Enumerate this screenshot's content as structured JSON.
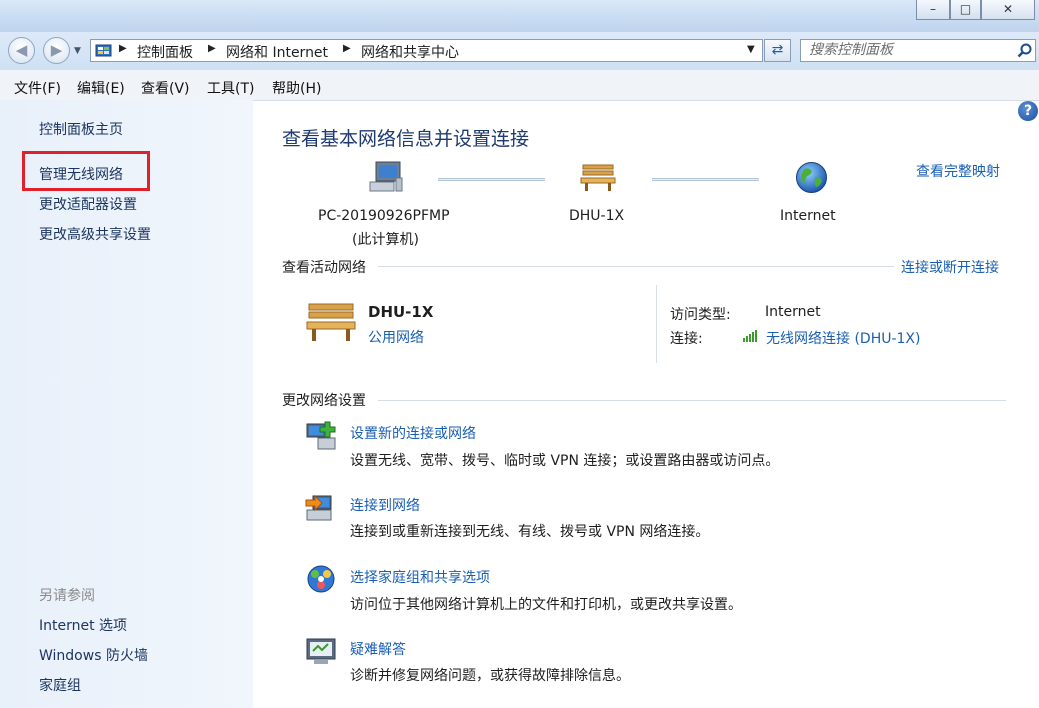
{
  "window": {
    "minimize": "–",
    "maximize": "□",
    "close": "✕"
  },
  "address": {
    "breadcrumb": [
      "控制面板",
      "网络和 Internet",
      "网络和共享中心"
    ],
    "search_placeholder": "搜索控制面板"
  },
  "menu": [
    "文件(F)",
    "编辑(E)",
    "查看(V)",
    "工具(T)",
    "帮助(H)"
  ],
  "sidebar": {
    "home": "控制面板主页",
    "links": [
      "管理无线网络",
      "更改适配器设置",
      "更改高级共享设置"
    ],
    "see_also_title": "另请参阅",
    "see_also": [
      "Internet 选项",
      "Windows 防火墙",
      "家庭组"
    ]
  },
  "main": {
    "title": "查看基本网络信息并设置连接",
    "view_full_map": "查看完整映射",
    "map": {
      "computer_name": "PC-20190926PFMP",
      "computer_sub": "(此计算机)",
      "network_name": "DHU-1X",
      "internet_name": "Internet"
    },
    "active_networks": {
      "heading": "查看活动网络",
      "connect_link": "连接或断开连接",
      "network_name": "DHU-1X",
      "network_type": "公用网络",
      "access_type_label": "访问类型:",
      "access_type_value": "Internet",
      "connections_label": "连接:",
      "connections_value": "无线网络连接 (DHU-1X)"
    },
    "change_settings": {
      "heading": "更改网络设置",
      "items": [
        {
          "title": "设置新的连接或网络",
          "desc": "设置无线、宽带、拨号、临时或 VPN 连接；或设置路由器或访问点。",
          "icon": "new-connection-icon"
        },
        {
          "title": "连接到网络",
          "desc": "连接到或重新连接到无线、有线、拨号或 VPN 网络连接。",
          "icon": "connect-network-icon"
        },
        {
          "title": "选择家庭组和共享选项",
          "desc": "访问位于其他网络计算机上的文件和打印机，或更改共享设置。",
          "icon": "homegroup-icon"
        },
        {
          "title": "疑难解答",
          "desc": "诊断并修复网络问题，或获得故障排除信息。",
          "icon": "troubleshoot-icon"
        }
      ]
    }
  },
  "colors": {
    "link": "#1a5fb4",
    "highlight_border": "#e0202a",
    "signal": "#3a9a2a"
  }
}
